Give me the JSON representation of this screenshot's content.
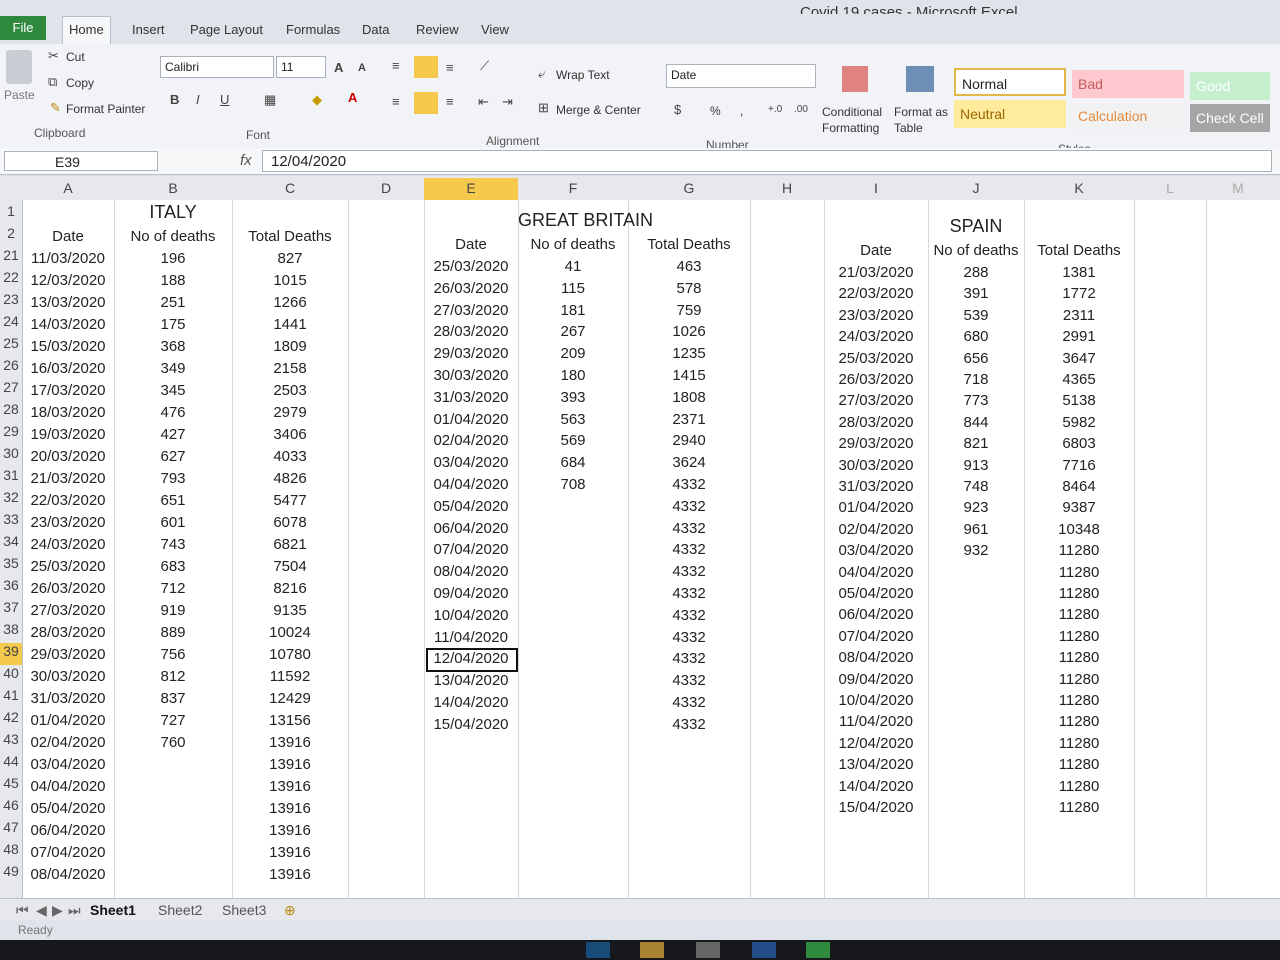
{
  "window": {
    "title": "Covid 19 cases  -  Microsoft Excel"
  },
  "tabs": [
    "File",
    "Home",
    "Insert",
    "Page Layout",
    "Formulas",
    "Data",
    "Review",
    "View"
  ],
  "clipboard": {
    "paste": "Paste",
    "cut": "Cut",
    "copy": "Copy",
    "format_painter": "Format Painter",
    "label": "Clipboard"
  },
  "font": {
    "name": "Calibri",
    "size": "11",
    "label": "Font",
    "bold": "B",
    "italic": "I",
    "underline": "U"
  },
  "alignment": {
    "wrap": "Wrap Text",
    "merge": "Merge & Center",
    "label": "Alignment"
  },
  "number": {
    "format": "Date",
    "percent": "%",
    "comma": ",",
    "label": "Number"
  },
  "styles": {
    "conditional": "Conditional Formatting",
    "format_table": "Format as Table",
    "normal": "Normal",
    "bad": "Bad",
    "good": "Good",
    "neutral": "Neutral",
    "calculation": "Calculation",
    "check_cell": "Check Cell",
    "label": "Styles"
  },
  "formula_bar": {
    "name_box": "E39",
    "fx": "fx",
    "value": "12/04/2020"
  },
  "columns": [
    "A",
    "B",
    "C",
    "D",
    "E",
    "F",
    "G",
    "H",
    "I",
    "J",
    "K",
    "L",
    "M"
  ],
  "headers": {
    "italy": "ITALY",
    "gb": "GREAT BRITAIN",
    "spain": "SPAIN",
    "date": "Date",
    "no_deaths": "No of deaths",
    "total": "Total Deaths"
  },
  "row_numbers": [
    "1",
    "2",
    "21",
    "22",
    "23",
    "24",
    "25",
    "26",
    "27",
    "28",
    "29",
    "30",
    "31",
    "32",
    "33",
    "34",
    "35",
    "36",
    "37",
    "38",
    "39",
    "40",
    "41",
    "42",
    "43",
    "44",
    "45",
    "46",
    "47",
    "48",
    "49"
  ],
  "italy": [
    [
      "11/03/2020",
      "196",
      "827"
    ],
    [
      "12/03/2020",
      "188",
      "1015"
    ],
    [
      "13/03/2020",
      "251",
      "1266"
    ],
    [
      "14/03/2020",
      "175",
      "1441"
    ],
    [
      "15/03/2020",
      "368",
      "1809"
    ],
    [
      "16/03/2020",
      "349",
      "2158"
    ],
    [
      "17/03/2020",
      "345",
      "2503"
    ],
    [
      "18/03/2020",
      "476",
      "2979"
    ],
    [
      "19/03/2020",
      "427",
      "3406"
    ],
    [
      "20/03/2020",
      "627",
      "4033"
    ],
    [
      "21/03/2020",
      "793",
      "4826"
    ],
    [
      "22/03/2020",
      "651",
      "5477"
    ],
    [
      "23/03/2020",
      "601",
      "6078"
    ],
    [
      "24/03/2020",
      "743",
      "6821"
    ],
    [
      "25/03/2020",
      "683",
      "7504"
    ],
    [
      "26/03/2020",
      "712",
      "8216"
    ],
    [
      "27/03/2020",
      "919",
      "9135"
    ],
    [
      "28/03/2020",
      "889",
      "10024"
    ],
    [
      "29/03/2020",
      "756",
      "10780"
    ],
    [
      "30/03/2020",
      "812",
      "11592"
    ],
    [
      "31/03/2020",
      "837",
      "12429"
    ],
    [
      "01/04/2020",
      "727",
      "13156"
    ],
    [
      "02/04/2020",
      "760",
      "13916"
    ],
    [
      "03/04/2020",
      "",
      "13916"
    ],
    [
      "04/04/2020",
      "",
      "13916"
    ],
    [
      "05/04/2020",
      "",
      "13916"
    ],
    [
      "06/04/2020",
      "",
      "13916"
    ],
    [
      "07/04/2020",
      "",
      "13916"
    ],
    [
      "08/04/2020",
      "",
      "13916"
    ]
  ],
  "gb": [
    [
      "25/03/2020",
      "41",
      "463"
    ],
    [
      "26/03/2020",
      "115",
      "578"
    ],
    [
      "27/03/2020",
      "181",
      "759"
    ],
    [
      "28/03/2020",
      "267",
      "1026"
    ],
    [
      "29/03/2020",
      "209",
      "1235"
    ],
    [
      "30/03/2020",
      "180",
      "1415"
    ],
    [
      "31/03/2020",
      "393",
      "1808"
    ],
    [
      "01/04/2020",
      "563",
      "2371"
    ],
    [
      "02/04/2020",
      "569",
      "2940"
    ],
    [
      "03/04/2020",
      "684",
      "3624"
    ],
    [
      "04/04/2020",
      "708",
      "4332"
    ],
    [
      "05/04/2020",
      "",
      "4332"
    ],
    [
      "06/04/2020",
      "",
      "4332"
    ],
    [
      "07/04/2020",
      "",
      "4332"
    ],
    [
      "08/04/2020",
      "",
      "4332"
    ],
    [
      "09/04/2020",
      "",
      "4332"
    ],
    [
      "10/04/2020",
      "",
      "4332"
    ],
    [
      "11/04/2020",
      "",
      "4332"
    ],
    [
      "12/04/2020",
      "",
      "4332"
    ],
    [
      "13/04/2020",
      "",
      "4332"
    ],
    [
      "14/04/2020",
      "",
      "4332"
    ],
    [
      "15/04/2020",
      "",
      "4332"
    ]
  ],
  "spain": [
    [
      "21/03/2020",
      "288",
      "1381"
    ],
    [
      "22/03/2020",
      "391",
      "1772"
    ],
    [
      "23/03/2020",
      "539",
      "2311"
    ],
    [
      "24/03/2020",
      "680",
      "2991"
    ],
    [
      "25/03/2020",
      "656",
      "3647"
    ],
    [
      "26/03/2020",
      "718",
      "4365"
    ],
    [
      "27/03/2020",
      "773",
      "5138"
    ],
    [
      "28/03/2020",
      "844",
      "5982"
    ],
    [
      "29/03/2020",
      "821",
      "6803"
    ],
    [
      "30/03/2020",
      "913",
      "7716"
    ],
    [
      "31/03/2020",
      "748",
      "8464"
    ],
    [
      "01/04/2020",
      "923",
      "9387"
    ],
    [
      "02/04/2020",
      "961",
      "10348"
    ],
    [
      "03/04/2020",
      "932",
      "11280"
    ],
    [
      "04/04/2020",
      "",
      "11280"
    ],
    [
      "05/04/2020",
      "",
      "11280"
    ],
    [
      "06/04/2020",
      "",
      "11280"
    ],
    [
      "07/04/2020",
      "",
      "11280"
    ],
    [
      "08/04/2020",
      "",
      "11280"
    ],
    [
      "09/04/2020",
      "",
      "11280"
    ],
    [
      "10/04/2020",
      "",
      "11280"
    ],
    [
      "11/04/2020",
      "",
      "11280"
    ],
    [
      "12/04/2020",
      "",
      "11280"
    ],
    [
      "13/04/2020",
      "",
      "11280"
    ],
    [
      "14/04/2020",
      "",
      "11280"
    ],
    [
      "15/04/2020",
      "",
      "11280"
    ]
  ],
  "sheet_tabs": [
    "Sheet1",
    "Sheet2",
    "Sheet3"
  ],
  "status": "Ready",
  "colors": {
    "selected_header": "#f5c94c",
    "file_tab": "#2f8a3e",
    "neutral_fill": "#ffeb9c",
    "bad_fill": "#ffc7ce",
    "good_fill": "#c6efce"
  }
}
